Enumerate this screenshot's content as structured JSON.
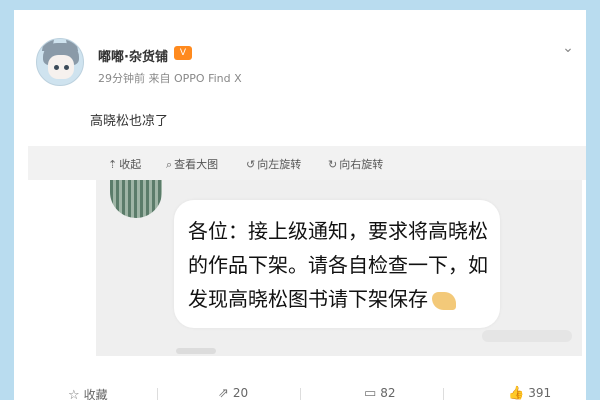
{
  "post": {
    "username": "嘟嘟·杂货铺",
    "vip_badge": "V",
    "meta": "29分钟前 来自 OPPO Find X",
    "text": "高晓松也凉了"
  },
  "image_toolbar": {
    "collapse": "收起",
    "view_large": "查看大图",
    "rotate_left": "向左旋转",
    "rotate_right": "向右旋转"
  },
  "image": {
    "bubble_text": "各位：接上级通知，要求将高晓松的作品下架。请各自检查一下，如发现高晓松图书请下架保存"
  },
  "actions": {
    "favorite_label": "收藏",
    "repost_count": "20",
    "comment_count": "82",
    "like_count": "391"
  },
  "icons": {
    "collapse": "arrow-up-icon",
    "view_large": "magnifier-icon",
    "rotate_left": "rotate-left-icon",
    "rotate_right": "rotate-right-icon",
    "favorite": "star-icon",
    "repost": "share-icon",
    "comment": "comment-icon",
    "like": "thumbs-up-icon",
    "menu": "chevron-down-icon"
  },
  "colors": {
    "page_background": "#b9dcef",
    "card": "#ffffff",
    "toolbar": "#f2f2f2",
    "vip_badge": "#ff8a1e"
  }
}
